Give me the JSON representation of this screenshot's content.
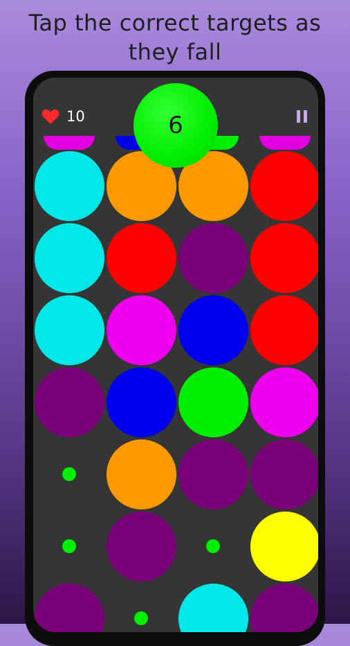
{
  "headline": "Tap the correct targets as\nthey fall",
  "hud": {
    "lives": "10",
    "heart_icon": "heart-icon",
    "pause_icon": "pause-icon",
    "score": "6",
    "score_color": "#00ee00"
  },
  "targets": [
    "#e000e0",
    "#0000e6",
    "#00ee00",
    "#e000e0"
  ],
  "colors": {
    "cyan": "#00e8e8",
    "orange": "#ff9900",
    "red": "#ff0000",
    "purple": "#7a007a",
    "magenta": "#ee00ee",
    "blue": "#0000ee",
    "green": "#00ee00",
    "yellow": "#ffff00"
  },
  "grid": [
    [
      "cyan",
      "orange",
      "orange",
      "red"
    ],
    [
      "cyan",
      "red",
      "purple",
      "red"
    ],
    [
      "cyan",
      "magenta",
      "blue",
      "red"
    ],
    [
      "purple",
      "blue",
      "green",
      "magenta"
    ],
    [
      "dot",
      "orange",
      "purple",
      "purple"
    ],
    [
      "dot",
      "purple",
      "dot",
      "yellow"
    ],
    [
      "purple",
      "dot",
      "cyan",
      "purple"
    ]
  ]
}
